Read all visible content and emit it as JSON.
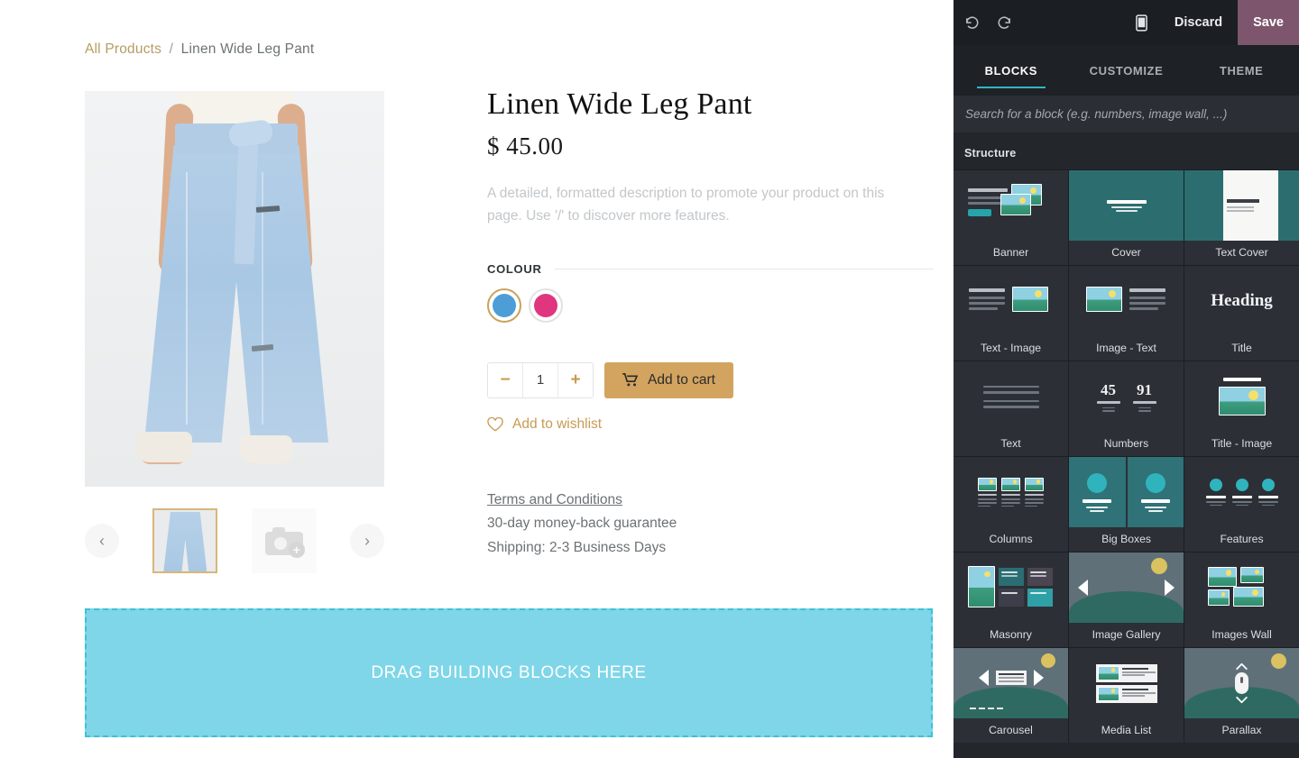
{
  "page": {
    "breadcrumb": {
      "root": "All Products",
      "separator": "/",
      "current": "Linen Wide Leg Pant"
    },
    "product": {
      "title": "Linen Wide Leg Pant",
      "price": "$ 45.00",
      "description": "A detailed, formatted description to promote your product on this page. Use '/' to discover more features.",
      "attribute_label": "COLOUR",
      "swatches": [
        {
          "name": "blue",
          "hex": "#4d9ed6",
          "selected": true
        },
        {
          "name": "pink",
          "hex": "#e0357f",
          "selected": false
        }
      ],
      "quantity": "1",
      "decrease_label": "−",
      "increase_label": "+",
      "add_to_cart_label": "Add to cart",
      "wishlist_label": "Add to wishlist",
      "terms_link": "Terms and Conditions",
      "guarantee": "30-day money-back guarantee",
      "shipping": "Shipping: 2-3 Business Days"
    },
    "gallery": {
      "prev_label": "‹",
      "next_label": "›",
      "thumb_selected_alt": "Linen Wide Leg Pant thumbnail",
      "thumb_add_alt": "Add image"
    },
    "dropzone": {
      "text": "DRAG BUILDING BLOCKS HERE",
      "fill": "#7fd6e8",
      "border": "#3ec0d8"
    }
  },
  "editor": {
    "toolbar": {
      "undo_label": "↺",
      "redo_label": "↻",
      "mobile_label": "",
      "discard_label": "Discard",
      "save_label": "Save",
      "save_color": "#7d566e"
    },
    "tabs": [
      {
        "label": "BLOCKS",
        "active": true
      },
      {
        "label": "CUSTOMIZE",
        "active": false
      },
      {
        "label": "THEME",
        "active": false
      }
    ],
    "search": {
      "placeholder": "Search for a block (e.g. numbers, image wall, ...)",
      "value": ""
    },
    "sections": [
      {
        "title": "Structure",
        "blocks": [
          {
            "label": "Banner",
            "art": "banner"
          },
          {
            "label": "Cover",
            "art": "cover"
          },
          {
            "label": "Text Cover",
            "art": "text-cover"
          },
          {
            "label": "Text - Image",
            "art": "text-image"
          },
          {
            "label": "Image - Text",
            "art": "image-text"
          },
          {
            "label": "Title",
            "art": "title",
            "sample_text": "Heading"
          },
          {
            "label": "Text",
            "art": "text"
          },
          {
            "label": "Numbers",
            "art": "numbers",
            "sample_numbers": [
              "45",
              "91"
            ]
          },
          {
            "label": "Title - Image",
            "art": "title-image"
          },
          {
            "label": "Columns",
            "art": "columns"
          },
          {
            "label": "Big Boxes",
            "art": "big-boxes"
          },
          {
            "label": "Features",
            "art": "features"
          },
          {
            "label": "Masonry",
            "art": "masonry"
          },
          {
            "label": "Image Gallery",
            "art": "image-gallery"
          },
          {
            "label": "Images Wall",
            "art": "images-wall"
          },
          {
            "label": "Carousel",
            "art": "carousel"
          },
          {
            "label": "Media List",
            "art": "media-list"
          },
          {
            "label": "Parallax",
            "art": "parallax"
          }
        ]
      }
    ]
  }
}
